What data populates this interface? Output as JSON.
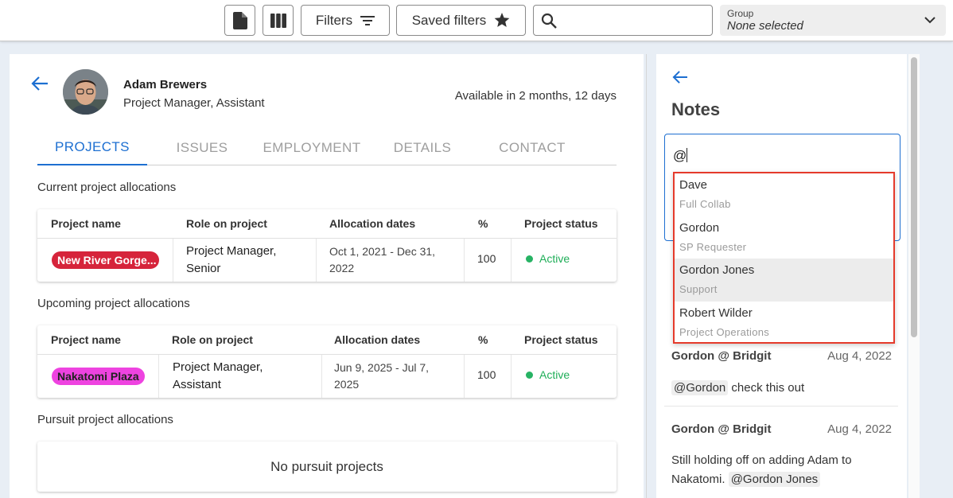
{
  "toolbar": {
    "filters_label": "Filters",
    "saved_filters_label": "Saved filters",
    "search_placeholder": "",
    "group_label": "Group",
    "group_value": "None selected"
  },
  "person": {
    "name": "Adam Brewers",
    "role": "Project Manager, Assistant",
    "availability": "Available in 2 months, 12 days"
  },
  "tabs": [
    "PROJECTS",
    "ISSUES",
    "EMPLOYMENT",
    "DETAILS",
    "CONTACT"
  ],
  "active_tab": "PROJECTS",
  "current": {
    "title": "Current project allocations",
    "headers": [
      "Project name",
      "Role on project",
      "Allocation dates",
      "%",
      "Project status"
    ],
    "row": {
      "project": "New River Gorge...",
      "project_color": "#d6243b",
      "role_line1": "Project Manager,",
      "role_line2": "Senior",
      "dates_line1": "Oct 1, 2021 - Dec 31,",
      "dates_line2": "2022",
      "percent": "100",
      "status": "Active"
    }
  },
  "upcoming": {
    "title": "Upcoming project allocations",
    "headers": [
      "Project name",
      "Role on project",
      "Allocation dates",
      "%",
      "Project status"
    ],
    "row": {
      "project": "Nakatomi Plaza",
      "project_color": "#ee43e0",
      "role_line1": "Project Manager,",
      "role_line2": "Assistant",
      "dates_line1": "Jun 9, 2025 - Jul 7,",
      "dates_line2": "2025",
      "percent": "100",
      "status": "Active"
    }
  },
  "pursuit": {
    "title": "Pursuit project allocations",
    "empty_text": "No pursuit projects"
  },
  "notes": {
    "title": "Notes",
    "input_value": "@",
    "mention_options": [
      {
        "name": "Dave",
        "sub": "Full Collab"
      },
      {
        "name": "Gordon",
        "sub": "SP Requester"
      },
      {
        "name": "Gordon Jones",
        "sub": "Support"
      },
      {
        "name": "Robert Wilder",
        "sub": "Project Operations"
      }
    ],
    "highlighted_option": "Gordon Jones",
    "items": [
      {
        "author": "Gordon @ Bridgit",
        "date": "Aug 4, 2022",
        "mention": "@Gordon",
        "text": " check this out"
      },
      {
        "author": "Gordon @ Bridgit",
        "date": "Aug 4, 2022",
        "text": "Still holding off on adding Adam to Nakatomi. ",
        "mention": "@Gordon Jones"
      }
    ]
  },
  "colors": {
    "accent": "#1d6fd1",
    "active_status": "#1fae58",
    "dropdown_highlight_border": "#e53a2b"
  }
}
